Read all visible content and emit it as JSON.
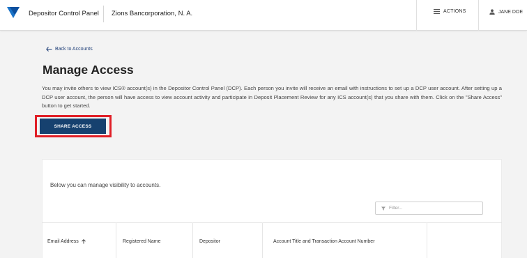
{
  "header": {
    "app_title": "Depositor Control Panel",
    "org_name": "Zions Bancorporation, N. A.",
    "actions_label": "ACTIONS",
    "user_name": "JANE DOE",
    "brand_color": "#1a73c8"
  },
  "back_link": {
    "label": "Back to Accounts"
  },
  "page": {
    "title": "Manage Access",
    "intro": "You may invite others to view ICS® account(s) in the Depositor Control Panel (DCP). Each person you invite will receive an email with instructions to set up a DCP user account. After setting up a DCP user account, the person will have access to view account activity and participate in Deposit Placement Review for any ICS account(s) that you share with them. Click on the \"Share Access\" button to get started."
  },
  "share_button": {
    "label": "SHARE ACCESS",
    "color": "#16416f",
    "highlight_color": "#e01e26"
  },
  "panel": {
    "description": "Below you can manage visibility to accounts.",
    "filter_placeholder": "Filter..."
  },
  "table": {
    "columns": [
      {
        "label": "Email Address",
        "sort_icon": "sort-up-arrow-icon"
      },
      {
        "label": "Registered Name"
      },
      {
        "label": "Depositor"
      },
      {
        "label": "Account Title and Transaction Account Number"
      }
    ]
  }
}
